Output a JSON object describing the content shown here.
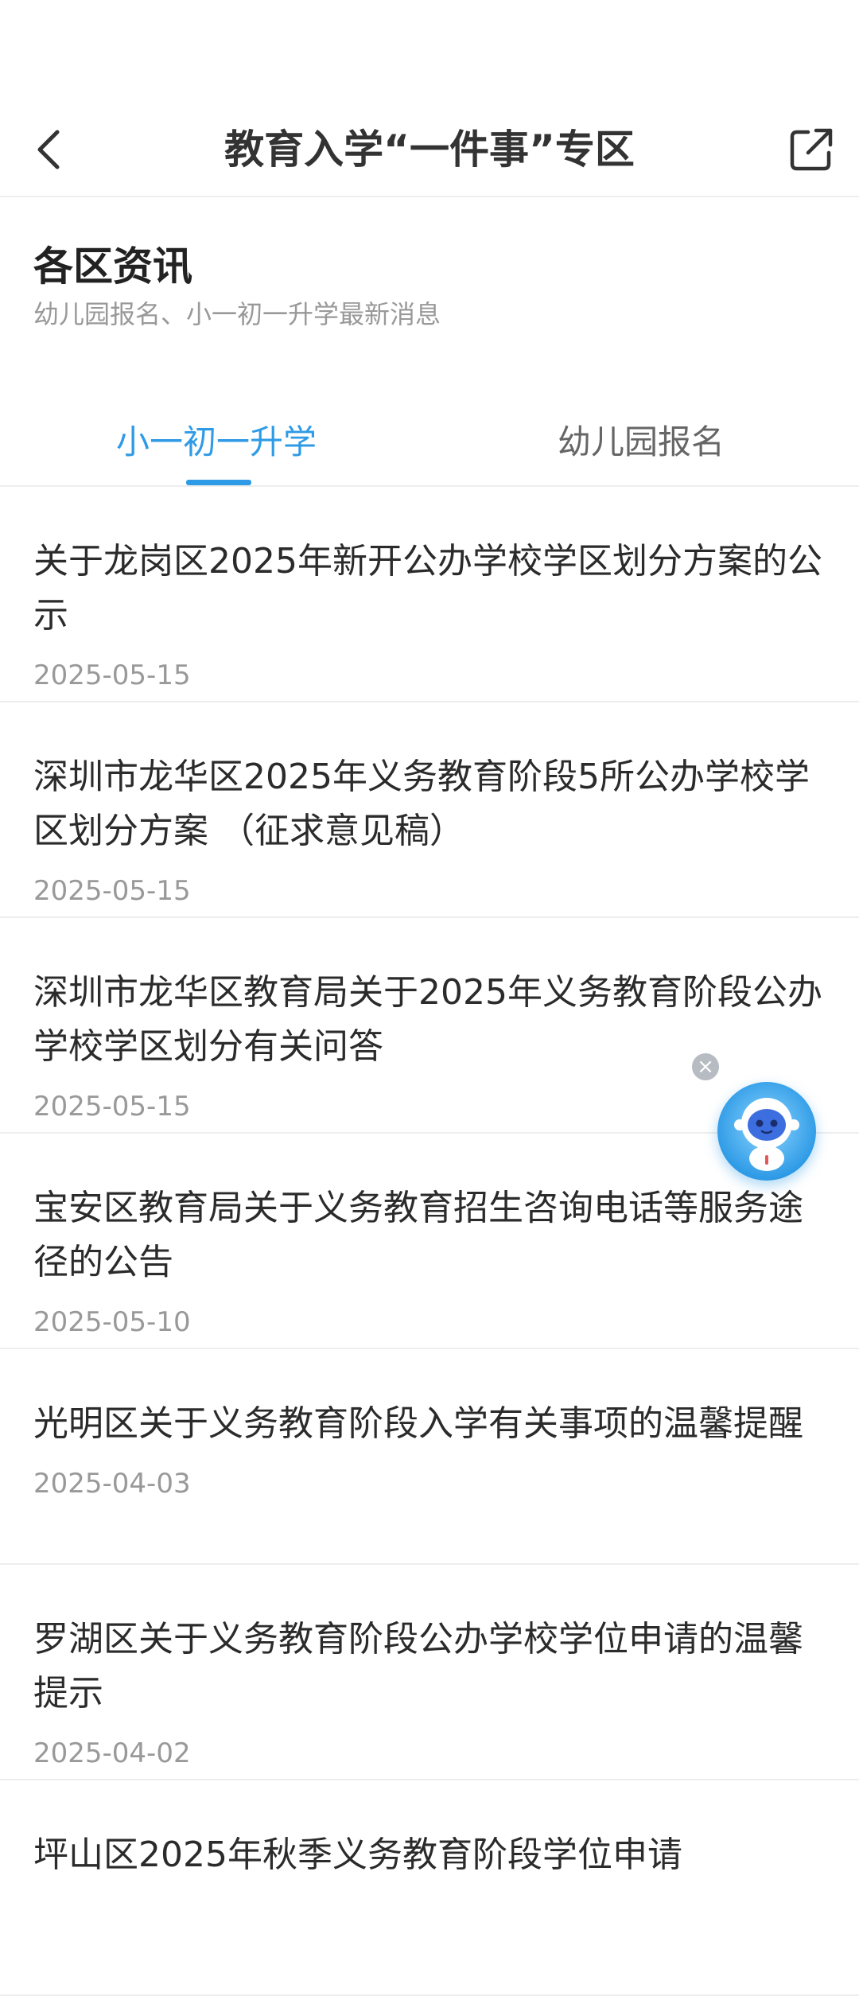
{
  "header": {
    "title": "教育入学“一件事”专区",
    "back_icon": "chevron-left-icon",
    "share_icon": "share-external-icon"
  },
  "section": {
    "title": "各区资讯",
    "subtitle": "幼儿园报名、小一初一升学最新消息"
  },
  "tabs": [
    {
      "label": "小一初一升学",
      "active": true
    },
    {
      "label": "幼儿园报名",
      "active": false
    }
  ],
  "accent_color": "#2f9be6",
  "news": [
    {
      "title": "关于龙岗区2025年新开公办学校学区划分方案的公示",
      "date": "2025-05-15"
    },
    {
      "title": "深圳市龙华区2025年义务教育阶段5所公办学校学区划分方案 （征求意见稿）",
      "date": "2025-05-15"
    },
    {
      "title": "深圳市龙华区教育局关于2025年义务教育阶段公办学校学区划分有关问答",
      "date": "2025-05-15"
    },
    {
      "title": "宝安区教育局关于义务教育招生咨询电话等服务途径的公告",
      "date": "2025-05-10"
    },
    {
      "title": "光明区关于义务教育阶段入学有关事项的温馨提醒",
      "date": "2025-04-03"
    },
    {
      "title": "罗湖区关于义务教育阶段公办学校学位申请的温馨提示",
      "date": "2025-04-02"
    },
    {
      "title": "坪山区2025年秋季义务教育阶段学位申请",
      "date": ""
    }
  ],
  "assistant": {
    "icon": "robot-assistant-icon",
    "close_icon": "close-icon"
  }
}
